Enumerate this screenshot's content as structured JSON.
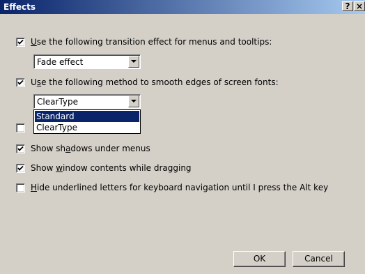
{
  "window": {
    "title": "Effects",
    "help": "?",
    "close": "×"
  },
  "options": [
    {
      "pre": "",
      "accel": "U",
      "post": "se the following transition effect for menus and tooltips:",
      "checked": true
    },
    {
      "pre": "U",
      "accel": "s",
      "post": "e the following method to smooth edges of screen fonts:",
      "checked": true
    },
    {
      "pre": "",
      "accel": "",
      "post": "",
      "checked": false
    },
    {
      "pre": "Show sh",
      "accel": "a",
      "post": "dows under menus",
      "checked": true
    },
    {
      "pre": "Show ",
      "accel": "w",
      "post": "indow contents while dragging",
      "checked": true
    },
    {
      "pre": "",
      "accel": "H",
      "post": "ide underlined letters for keyboard navigation until I press the Alt key",
      "checked": false
    }
  ],
  "transition_combo": {
    "value": "Fade effect"
  },
  "smoothing_combo": {
    "value": "ClearType",
    "options": [
      "Standard",
      "ClearType"
    ],
    "selected": "Standard"
  },
  "buttons": {
    "ok": "OK",
    "cancel": "Cancel"
  }
}
